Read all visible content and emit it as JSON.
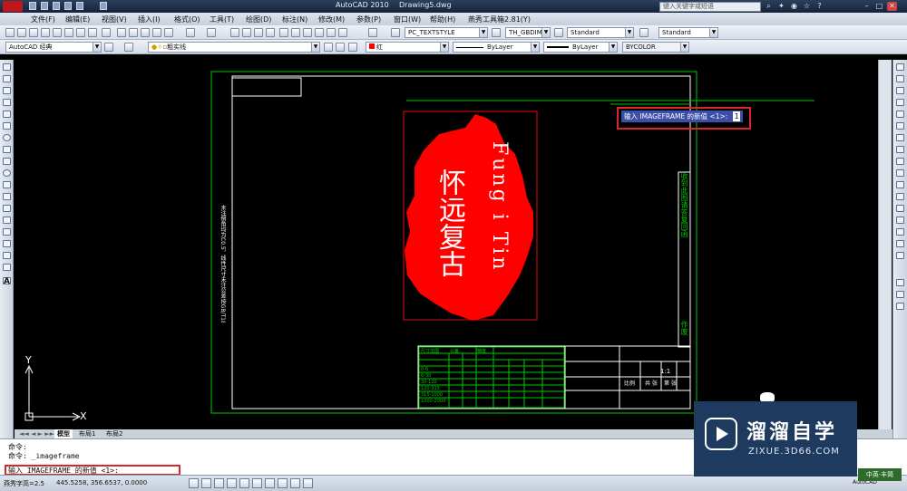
{
  "titlebar": {
    "app": "AutoCAD 2010",
    "file": "Drawing5.dwg",
    "search_placeholder": "键入关键字或短语"
  },
  "menus": [
    "文件(F)",
    "编辑(E)",
    "视图(V)",
    "插入(I)",
    "格式(O)",
    "工具(T)",
    "绘图(D)",
    "标注(N)",
    "修改(M)",
    "参数(P)",
    "窗口(W)",
    "帮助(H)",
    "燕秀工具箱2.81(Y)"
  ],
  "toolbar1": {
    "textstyle": "PC_TEXTSTYLE",
    "dimstyle": "TH_GBDIM",
    "tablestyle": "Standard",
    "mleaderstyle": "Standard"
  },
  "toolbar2": {
    "workspace": "AutoCAD 经典",
    "layer": "粗实线",
    "color": "红",
    "linetype": "ByLayer",
    "lineweight": "ByLayer",
    "plotstyle": "BYCOLOR"
  },
  "colors": {
    "accent": "#c0171d",
    "seal_red": "#ff0000",
    "frame_green": "#00c800",
    "highlight_box": "#d9262a",
    "dyn_bg": "#3b4fa8"
  },
  "drawing": {
    "dynamic_prompt": "输入 IMAGEFRAME 的新值 <1>:",
    "dynamic_value": "1",
    "seal_title": "怀远复古",
    "seal_roman": "Fung i Tin",
    "vertical_note": "未注倒角均为C0.5，线性尺寸未注公差按GB/T1804-m，不得锐边毛刺",
    "title_cells": [
      "收到此图请答复回函",
      "作废"
    ],
    "block_labels": [
      "1:1",
      "比例",
      "共 张",
      "第 张"
    ],
    "table_head": [
      "尺寸范围",
      "公差",
      "精度"
    ],
    "table_rows": [
      "0-6",
      "6-30",
      "30-120",
      "120-315",
      "315-1000",
      "1000-2000"
    ]
  },
  "tabs": [
    "模型",
    "布局1",
    "布局2"
  ],
  "command": {
    "line1": "命令:",
    "line2": "命令: _imageframe",
    "prompt": "输入 IMAGEFRAME 的新值 <1>:"
  },
  "status": {
    "left": "燕秀字高=2.5",
    "coords": "445.5258, 356.6537, 0.0000",
    "right": "AutoCAD"
  },
  "ucs": {
    "x": "X",
    "y": "Y"
  },
  "watermark": {
    "brand": "溜溜自学",
    "url": "ZIXUE.3D66.COM",
    "corner": "中英·丰简"
  }
}
